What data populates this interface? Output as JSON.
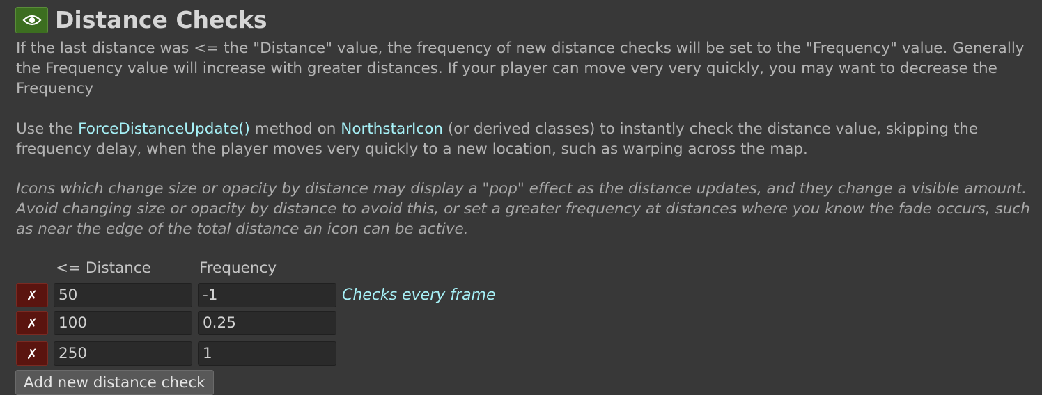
{
  "section": {
    "title": "Distance Checks",
    "icon": "eye-icon"
  },
  "description": {
    "p1": "If the last distance was <= the \"Distance\" value, the frequency of new distance checks will be set to the \"Frequency\" value. Generally the Frequency value will increase with greater distances. If your player can move very very quickly, you may want to decrease the Frequency",
    "p2_before": "Use the ",
    "p2_method": "ForceDistanceUpdate()",
    "p2_mid": " method on ",
    "p2_class": "NorthstarIcon",
    "p2_after": " (or derived classes) to instantly check the distance value, skipping the frequency delay, when the player moves very quickly to a new location, such as warping across the map.",
    "p3": "Icons which change size or opacity by distance may display a \"pop\" effect as the distance updates, and they change a visible amount. Avoid changing size or opacity by distance to avoid this, or set a greater frequency at distances where you know the fade occurs, such as near the edge of the total distance an icon can be active."
  },
  "table": {
    "distance_header": "<= Distance",
    "frequency_header": "Frequency",
    "delete_label": "✗",
    "rows": [
      {
        "distance": "50",
        "frequency": "-1",
        "note": "Checks every frame"
      },
      {
        "distance": "100",
        "frequency": "0.25",
        "note": ""
      },
      {
        "distance": "250",
        "frequency": "1",
        "note": ""
      }
    ]
  },
  "add_button_label": "Add new distance check",
  "colors": {
    "background": "#383838",
    "highlight": "#a6f0f6",
    "eye_button": "#3c6e20",
    "delete_button": "#5a140f"
  }
}
